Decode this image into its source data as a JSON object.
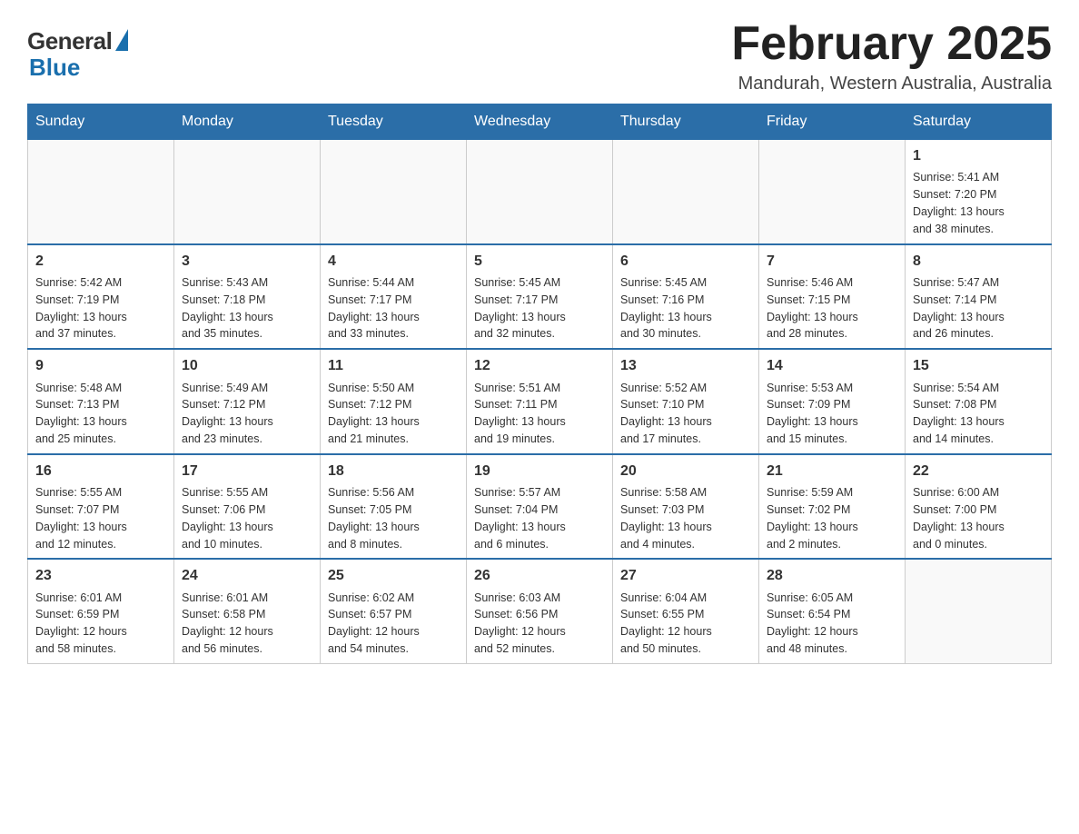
{
  "logo": {
    "general": "General",
    "blue": "Blue"
  },
  "title": "February 2025",
  "subtitle": "Mandurah, Western Australia, Australia",
  "weekdays": [
    "Sunday",
    "Monday",
    "Tuesday",
    "Wednesday",
    "Thursday",
    "Friday",
    "Saturday"
  ],
  "weeks": [
    [
      {
        "day": "",
        "info": ""
      },
      {
        "day": "",
        "info": ""
      },
      {
        "day": "",
        "info": ""
      },
      {
        "day": "",
        "info": ""
      },
      {
        "day": "",
        "info": ""
      },
      {
        "day": "",
        "info": ""
      },
      {
        "day": "1",
        "info": "Sunrise: 5:41 AM\nSunset: 7:20 PM\nDaylight: 13 hours\nand 38 minutes."
      }
    ],
    [
      {
        "day": "2",
        "info": "Sunrise: 5:42 AM\nSunset: 7:19 PM\nDaylight: 13 hours\nand 37 minutes."
      },
      {
        "day": "3",
        "info": "Sunrise: 5:43 AM\nSunset: 7:18 PM\nDaylight: 13 hours\nand 35 minutes."
      },
      {
        "day": "4",
        "info": "Sunrise: 5:44 AM\nSunset: 7:17 PM\nDaylight: 13 hours\nand 33 minutes."
      },
      {
        "day": "5",
        "info": "Sunrise: 5:45 AM\nSunset: 7:17 PM\nDaylight: 13 hours\nand 32 minutes."
      },
      {
        "day": "6",
        "info": "Sunrise: 5:45 AM\nSunset: 7:16 PM\nDaylight: 13 hours\nand 30 minutes."
      },
      {
        "day": "7",
        "info": "Sunrise: 5:46 AM\nSunset: 7:15 PM\nDaylight: 13 hours\nand 28 minutes."
      },
      {
        "day": "8",
        "info": "Sunrise: 5:47 AM\nSunset: 7:14 PM\nDaylight: 13 hours\nand 26 minutes."
      }
    ],
    [
      {
        "day": "9",
        "info": "Sunrise: 5:48 AM\nSunset: 7:13 PM\nDaylight: 13 hours\nand 25 minutes."
      },
      {
        "day": "10",
        "info": "Sunrise: 5:49 AM\nSunset: 7:12 PM\nDaylight: 13 hours\nand 23 minutes."
      },
      {
        "day": "11",
        "info": "Sunrise: 5:50 AM\nSunset: 7:12 PM\nDaylight: 13 hours\nand 21 minutes."
      },
      {
        "day": "12",
        "info": "Sunrise: 5:51 AM\nSunset: 7:11 PM\nDaylight: 13 hours\nand 19 minutes."
      },
      {
        "day": "13",
        "info": "Sunrise: 5:52 AM\nSunset: 7:10 PM\nDaylight: 13 hours\nand 17 minutes."
      },
      {
        "day": "14",
        "info": "Sunrise: 5:53 AM\nSunset: 7:09 PM\nDaylight: 13 hours\nand 15 minutes."
      },
      {
        "day": "15",
        "info": "Sunrise: 5:54 AM\nSunset: 7:08 PM\nDaylight: 13 hours\nand 14 minutes."
      }
    ],
    [
      {
        "day": "16",
        "info": "Sunrise: 5:55 AM\nSunset: 7:07 PM\nDaylight: 13 hours\nand 12 minutes."
      },
      {
        "day": "17",
        "info": "Sunrise: 5:55 AM\nSunset: 7:06 PM\nDaylight: 13 hours\nand 10 minutes."
      },
      {
        "day": "18",
        "info": "Sunrise: 5:56 AM\nSunset: 7:05 PM\nDaylight: 13 hours\nand 8 minutes."
      },
      {
        "day": "19",
        "info": "Sunrise: 5:57 AM\nSunset: 7:04 PM\nDaylight: 13 hours\nand 6 minutes."
      },
      {
        "day": "20",
        "info": "Sunrise: 5:58 AM\nSunset: 7:03 PM\nDaylight: 13 hours\nand 4 minutes."
      },
      {
        "day": "21",
        "info": "Sunrise: 5:59 AM\nSunset: 7:02 PM\nDaylight: 13 hours\nand 2 minutes."
      },
      {
        "day": "22",
        "info": "Sunrise: 6:00 AM\nSunset: 7:00 PM\nDaylight: 13 hours\nand 0 minutes."
      }
    ],
    [
      {
        "day": "23",
        "info": "Sunrise: 6:01 AM\nSunset: 6:59 PM\nDaylight: 12 hours\nand 58 minutes."
      },
      {
        "day": "24",
        "info": "Sunrise: 6:01 AM\nSunset: 6:58 PM\nDaylight: 12 hours\nand 56 minutes."
      },
      {
        "day": "25",
        "info": "Sunrise: 6:02 AM\nSunset: 6:57 PM\nDaylight: 12 hours\nand 54 minutes."
      },
      {
        "day": "26",
        "info": "Sunrise: 6:03 AM\nSunset: 6:56 PM\nDaylight: 12 hours\nand 52 minutes."
      },
      {
        "day": "27",
        "info": "Sunrise: 6:04 AM\nSunset: 6:55 PM\nDaylight: 12 hours\nand 50 minutes."
      },
      {
        "day": "28",
        "info": "Sunrise: 6:05 AM\nSunset: 6:54 PM\nDaylight: 12 hours\nand 48 minutes."
      },
      {
        "day": "",
        "info": ""
      }
    ]
  ]
}
